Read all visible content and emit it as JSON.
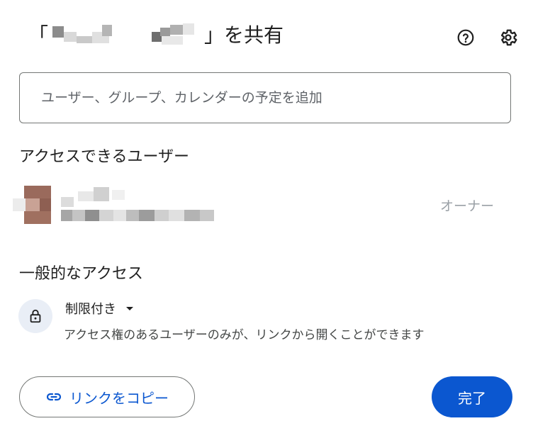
{
  "dialog": {
    "title_open": "「",
    "title_close": "」を共有",
    "help_icon": "help-circle-icon",
    "settings_icon": "gear-icon"
  },
  "share_input": {
    "placeholder": "ユーザー、グループ、カレンダーの予定を追加"
  },
  "people": {
    "heading": "アクセスできるユーザー",
    "items": [
      {
        "role": "オーナー"
      }
    ]
  },
  "general_access": {
    "heading": "一般的なアクセス",
    "icon": "lock-icon",
    "setting": "制限付き",
    "description": "アクセス権のあるユーザーのみが、リンクから開くことができます"
  },
  "actions": {
    "copy_link": "リンクをコピー",
    "done": "完了"
  },
  "colors": {
    "primary": "#0b57d0",
    "owner_text": "#9aa0a6"
  }
}
